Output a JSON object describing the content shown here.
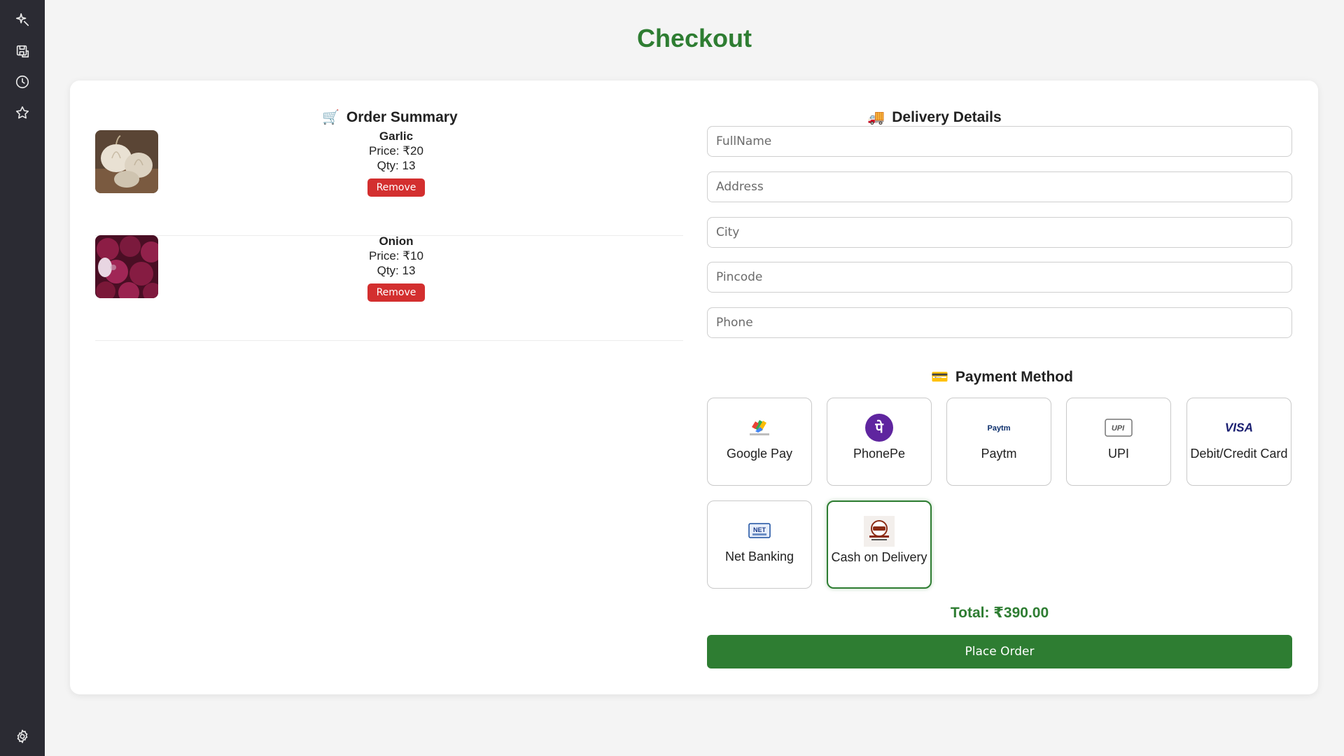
{
  "page": {
    "title": "Checkout"
  },
  "sidebar": {
    "icons": [
      "sparkle-icon",
      "save-icon",
      "history-icon",
      "star-icon",
      "settings-icon"
    ]
  },
  "order_summary": {
    "heading": "Order Summary",
    "heading_emoji": "🛒",
    "items": [
      {
        "name": "Garlic",
        "price": "Price: ₹20",
        "qty": "Qty: 13",
        "remove_label": "Remove"
      },
      {
        "name": "Onion",
        "price": "Price: ₹10",
        "qty": "Qty: 13",
        "remove_label": "Remove"
      }
    ]
  },
  "delivery": {
    "heading": "Delivery Details",
    "heading_emoji": "🚚",
    "fields": {
      "fullname": {
        "placeholder": "FullName",
        "value": ""
      },
      "address": {
        "placeholder": "Address",
        "value": ""
      },
      "city": {
        "placeholder": "City",
        "value": ""
      },
      "pincode": {
        "placeholder": "Pincode",
        "value": ""
      },
      "phone": {
        "placeholder": "Phone",
        "value": ""
      }
    }
  },
  "payment": {
    "heading": "Payment Method",
    "heading_emoji": "💳",
    "options": [
      {
        "label": "Google Pay",
        "icon": "google-pay-logo",
        "selected": false
      },
      {
        "label": "PhonePe",
        "icon": "phonepe-logo",
        "selected": false
      },
      {
        "label": "Paytm",
        "icon": "paytm-logo",
        "selected": false
      },
      {
        "label": "UPI",
        "icon": "upi-logo",
        "selected": false
      },
      {
        "label": "Debit/Credit Card",
        "icon": "visa-logo",
        "selected": false
      },
      {
        "label": "Net Banking",
        "icon": "net-banking-logo",
        "selected": false
      },
      {
        "label": "Cash on Delivery",
        "icon": "cash-on-delivery-logo",
        "selected": true
      }
    ],
    "logo_text": {
      "phonepe": "पे",
      "paytm": "Paytm",
      "upi": "UPI",
      "visa": "VISA",
      "net_banking": "NET"
    }
  },
  "total": {
    "label": "Total: ₹390.00"
  },
  "actions": {
    "place_order_label": "Place Order"
  },
  "colors": {
    "accent_green": "#2e7d32",
    "remove_red": "#d32f2f",
    "sidebar_bg": "#2b2b33",
    "page_bg": "#f4f4f4"
  }
}
